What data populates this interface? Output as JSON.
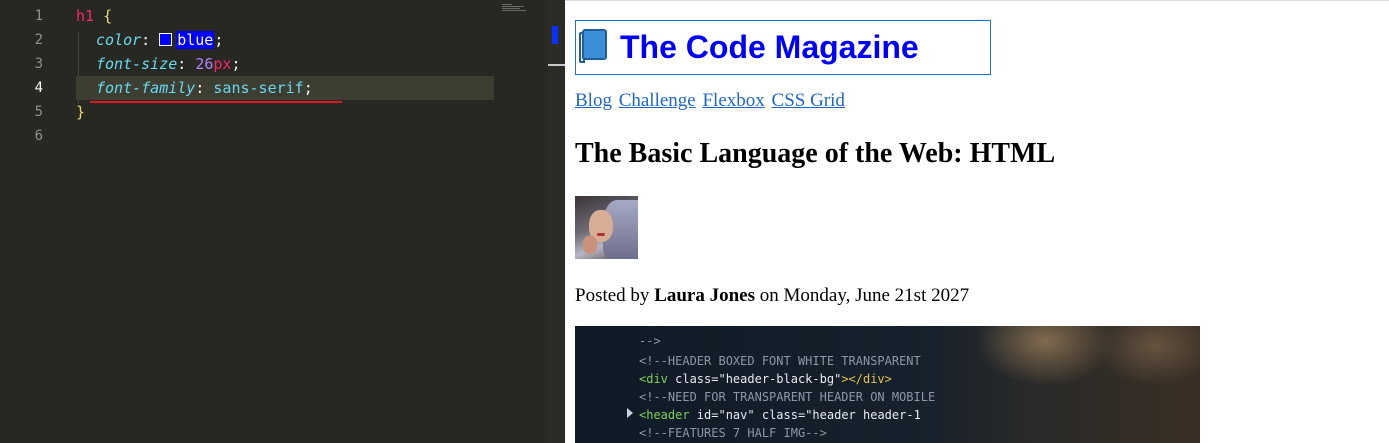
{
  "editor": {
    "line_numbers": [
      "1",
      "2",
      "3",
      "4",
      "5",
      "6"
    ],
    "active_line": "4",
    "code": {
      "selector": "h1",
      "open_brace": "{",
      "close_brace": "}",
      "colon": ":",
      "semicolon": ";",
      "color_prop": "color",
      "color_value": "blue",
      "color_swatch": "#0000ff",
      "size_prop": "font-size",
      "size_number": "26",
      "size_unit": "px",
      "family_prop": "font-family",
      "family_value": "sans-serif"
    }
  },
  "preview": {
    "site_title": "The Code Magazine",
    "title_icon": "book-icon",
    "title_color": "#0000ff",
    "nav": [
      "Blog",
      "Challenge",
      "Flexbox",
      "CSS Grid"
    ],
    "article_title": "The Basic Language of the Web: HTML",
    "byline_prefix": "Posted by",
    "author": "Laura Jones",
    "byline_suffix": "on Monday, June 21st 2027",
    "hero_code": {
      "line1": "<!--HEADER BOXED FONT WHITE TRANSPARENT",
      "line2a": "<div ",
      "line2b": "class=",
      "line2c": "\"header-black-bg\"",
      "line2d": "></div>",
      "line3": "<!--NEED FOR TRANSPARENT HEADER ON MOBILE",
      "line4a": "<header ",
      "line4b": "id=",
      "line4c": "\"nav\" ",
      "line4d": "class=",
      "line4e": "\"header header-1",
      "line5": "<!--FEATURES 7 HALF IMG-->",
      "line0": "-->"
    }
  }
}
